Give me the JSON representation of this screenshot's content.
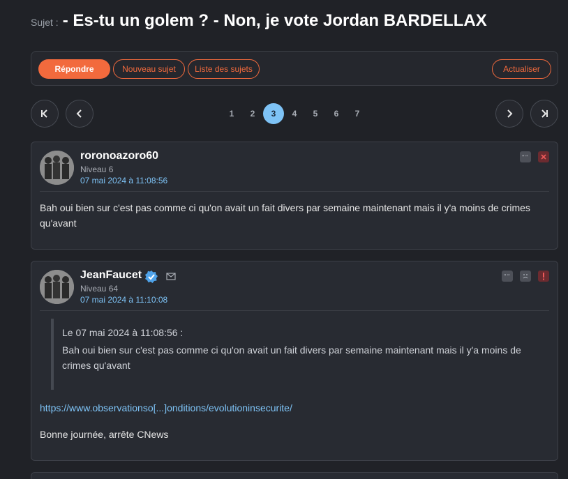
{
  "topic": {
    "prefix": "Sujet :",
    "title": "- Es-tu un golem ? - Non, je vote Jordan BARDELLAX"
  },
  "toolbar": {
    "reply_label": "Répondre",
    "new_topic_label": "Nouveau sujet",
    "topic_list_label": "Liste des sujets",
    "refresh_label": "Actualiser"
  },
  "pagination": {
    "pages": [
      "1",
      "2",
      "3",
      "4",
      "5",
      "6",
      "7"
    ],
    "current": "3"
  },
  "posts": [
    {
      "author": "roronoazoro60",
      "level": "Niveau 6",
      "date": "07 mai 2024 à 11:08:56",
      "body": "Bah oui bien sur c'est pas comme ci qu'on avait un fait divers par semaine maintenant mais il y'a moins de crimes qu'avant"
    },
    {
      "author": "JeanFaucet",
      "level": "Niveau 64",
      "date": "07 mai 2024 à 11:10:08",
      "quote_header": "Le 07 mai 2024 à 11:08:56 :",
      "quote_body": "Bah oui bien sur c'est pas comme ci qu'on avait un fait divers par semaine maintenant mais il y'a moins de crimes qu'avant",
      "link_text": "https://www.observationso[...]onditions/evolutioninsecurite/",
      "closing": "Bonne journée, arrête CNews"
    }
  ],
  "colors": {
    "accent": "#f26a3d",
    "link": "#7ec3f6",
    "background": "#202227",
    "card": "#282b32"
  }
}
